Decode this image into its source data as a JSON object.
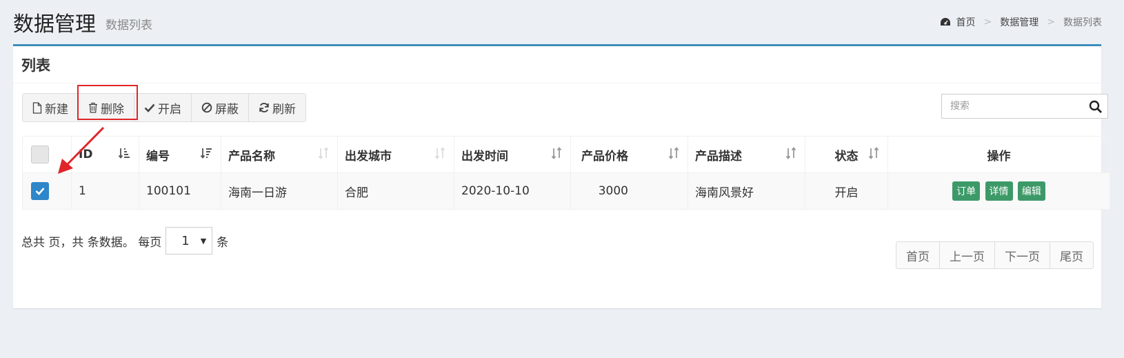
{
  "header": {
    "title": "数据管理",
    "subtitle": "数据列表",
    "breadcrumb": [
      "首页",
      "数据管理",
      "数据列表"
    ],
    "breadcrumb_sep": ">"
  },
  "box": {
    "title": "列表"
  },
  "toolbar": {
    "new_label": "新建",
    "delete_label": "删除",
    "enable_label": "开启",
    "block_label": "屏蔽",
    "refresh_label": "刷新"
  },
  "search": {
    "placeholder": "搜索"
  },
  "table": {
    "columns": [
      "ID",
      "编号",
      "产品名称",
      "出发城市",
      "出发时间",
      "产品价格",
      "产品描述",
      "状态",
      "操作"
    ],
    "rows": [
      {
        "checked": true,
        "id": "1",
        "code": "100101",
        "name": "海南一日游",
        "city": "合肥",
        "time": "2020-10-10",
        "price": "3000",
        "desc": "海南风景好",
        "status": "开启",
        "actions": [
          "订单",
          "详情",
          "编辑"
        ]
      }
    ]
  },
  "footer": {
    "text_prefix": "总共 页，共 条数据。 每页",
    "page_size": "1",
    "text_suffix": "条"
  },
  "pager": [
    "首页",
    "上一页",
    "下一页",
    "尾页"
  ],
  "colors": {
    "accent": "#3c8dbc",
    "checkbox": "#2f86c8",
    "action_button": "#3d9a68",
    "annotation": "#e0252a"
  }
}
